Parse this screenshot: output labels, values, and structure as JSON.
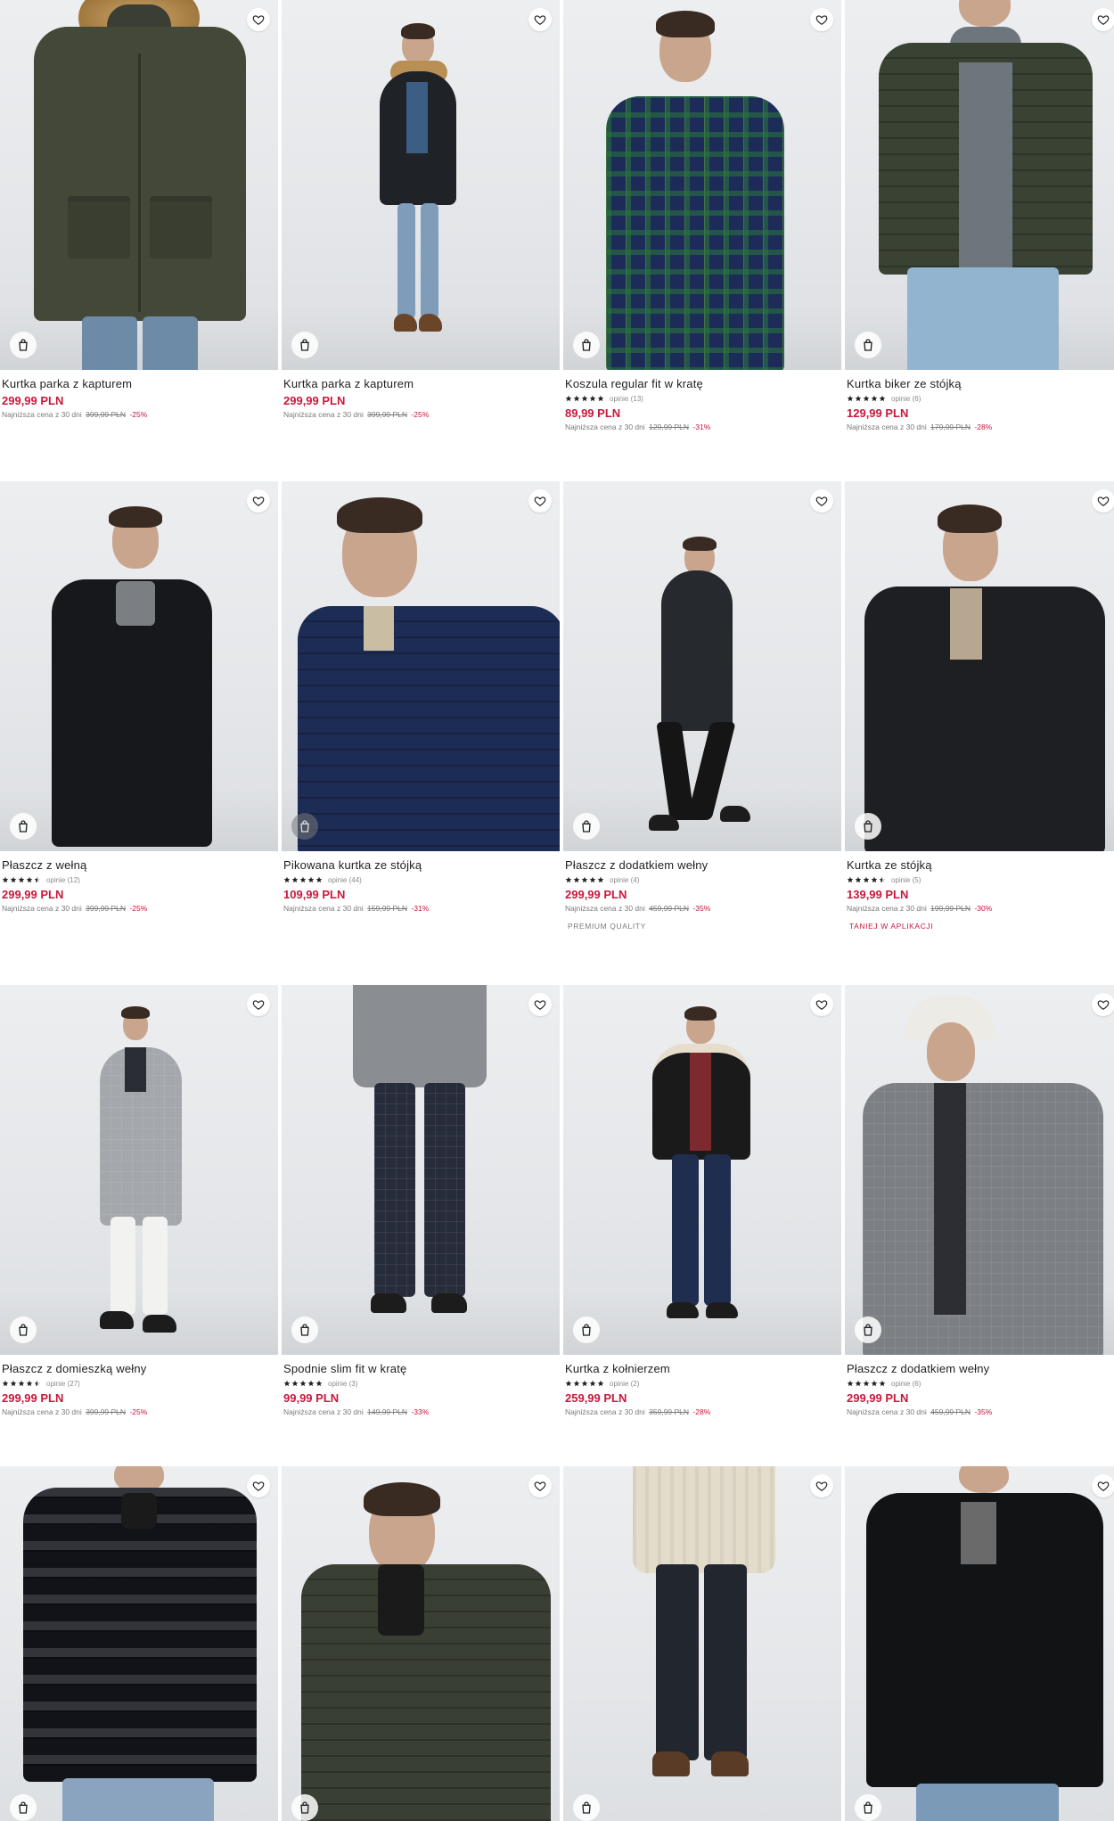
{
  "colors": {
    "price": "#c8183c",
    "text": "#1f1f1f",
    "muted": "#7a7a7a"
  },
  "icons": {
    "favorite": "heart-icon",
    "cart": "shopping-bag-icon",
    "star": "star-icon"
  },
  "products": [
    {
      "name": "Kurtka parka z kapturem",
      "price": "299,99 PLN",
      "lowest_label": "Najniższa cena z 30 dni",
      "old_price": "399,99 PLN",
      "discount": "-25%"
    },
    {
      "name": "Kurtka parka z kapturem",
      "price": "299,99 PLN",
      "lowest_label": "Najniższa cena z 30 dni",
      "old_price": "399,99 PLN",
      "discount": "-25%"
    },
    {
      "name": "Koszula regular fit w kratę",
      "rating": 5,
      "reviews": "opinie (13)",
      "price": "89,99 PLN",
      "lowest_label": "Najniższa cena z 30 dni",
      "old_price": "129,99 PLN",
      "discount": "-31%"
    },
    {
      "name": "Kurtka biker ze stójką",
      "rating": 5,
      "reviews": "opinie (6)",
      "price": "129,99 PLN",
      "lowest_label": "Najniższa cena z 30 dni",
      "old_price": "179,99 PLN",
      "discount": "-28%"
    },
    {
      "name": "Płaszcz z wełną",
      "rating": 4.5,
      "reviews": "opinie (12)",
      "price": "299,99 PLN",
      "lowest_label": "Najniższa cena z 30 dni",
      "old_price": "399,99 PLN",
      "discount": "-25%"
    },
    {
      "name": "Pikowana kurtka ze stójką",
      "rating": 5,
      "reviews": "opinie (44)",
      "price": "109,99 PLN",
      "lowest_label": "Najniższa cena z 30 dni",
      "old_price": "159,99 PLN",
      "discount": "-31%"
    },
    {
      "name": "Płaszcz z dodatkiem wełny",
      "rating": 5,
      "reviews": "opinie (4)",
      "price": "299,99 PLN",
      "lowest_label": "Najniższa cena z 30 dni",
      "old_price": "459,99 PLN",
      "discount": "-35%",
      "badge": "PREMIUM QUALITY",
      "badge_color": "grey"
    },
    {
      "name": "Kurtka ze stójką",
      "rating": 4.5,
      "reviews": "opinie (5)",
      "price": "139,99 PLN",
      "lowest_label": "Najniższa cena z 30 dni",
      "old_price": "199,99 PLN",
      "discount": "-30%",
      "badge": "TANIEJ W APLIKACJI",
      "badge_color": "red"
    },
    {
      "name": "Płaszcz z domieszką wełny",
      "rating": 4.5,
      "reviews": "opinie (27)",
      "price": "299,99 PLN",
      "lowest_label": "Najniższa cena z 30 dni",
      "old_price": "399,99 PLN",
      "discount": "-25%"
    },
    {
      "name": "Spodnie slim fit w kratę",
      "rating": 5,
      "reviews": "opinie (3)",
      "price": "99,99 PLN",
      "lowest_label": "Najniższa cena z 30 dni",
      "old_price": "149,99 PLN",
      "discount": "-33%"
    },
    {
      "name": "Kurtka z kołnierzem",
      "rating": 5,
      "reviews": "opinie (2)",
      "price": "259,99 PLN",
      "lowest_label": "Najniższa cena z 30 dni",
      "old_price": "359,99 PLN",
      "discount": "-28%"
    },
    {
      "name": "Płaszcz z dodatkiem wełny",
      "rating": 5,
      "reviews": "opinie (6)",
      "price": "299,99 PLN",
      "lowest_label": "Najniższa cena z 30 dni",
      "old_price": "459,99 PLN",
      "discount": "-35%"
    },
    {
      "name": ""
    },
    {
      "name": ""
    },
    {
      "name": ""
    },
    {
      "name": ""
    }
  ]
}
